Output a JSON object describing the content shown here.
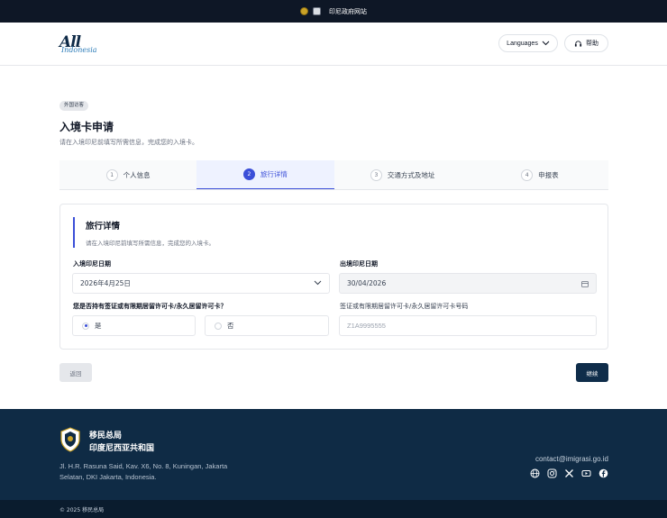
{
  "topbar": {
    "gov_site": "印尼政府网站"
  },
  "header": {
    "logo_main": "All",
    "logo_sub": "Indonesia",
    "languages_label": "Languages",
    "help_label": "帮助"
  },
  "page": {
    "badge": "外国访客",
    "title": "入境卡申请",
    "subtitle": "请在入境印尼前填写所需信息，完成您的入境卡。"
  },
  "steps": [
    {
      "num": "1",
      "label": "个人信息",
      "active": false
    },
    {
      "num": "2",
      "label": "旅行详情",
      "active": true
    },
    {
      "num": "3",
      "label": "交通方式及地址",
      "active": false
    },
    {
      "num": "4",
      "label": "申报表",
      "active": false
    }
  ],
  "form": {
    "section_title": "旅行详情",
    "section_sub": "请在入境印尼前填写所需信息，完成您的入境卡。",
    "arrival_label": "入境印尼日期",
    "arrival_value": "2026年4月25日",
    "departure_label": "出境印尼日期",
    "departure_value": "30/04/2026",
    "visa_question": "您是否持有签证或有限期居留许可卡/永久居留许可卡？",
    "yes_label": "是",
    "no_label": "否",
    "visa_number_label": "签证或有限期居留许可卡/永久居留许可卡号码",
    "visa_number_placeholder": "Z1A9995555",
    "selected_option": "是"
  },
  "actions": {
    "back_label": "返回",
    "next_label": "继续"
  },
  "footer": {
    "org_line1": "移民总局",
    "org_line2": "印度尼西亚共和国",
    "address": "Jl. H.R. Rasuna Said, Kav. X6, No. 8, Kuningan, Jakarta Selatan, DKI Jakarta, Indonesia.",
    "contact": "contact@imigrasi.go.id",
    "socials": [
      "globe-icon",
      "instagram-icon",
      "x-icon",
      "youtube-icon",
      "facebook-icon"
    ],
    "copyright": "© 2025 移民总局"
  },
  "colors": {
    "accent": "#3b4fd8",
    "navy": "#0f2d4a",
    "footer": "#0f2b45"
  }
}
